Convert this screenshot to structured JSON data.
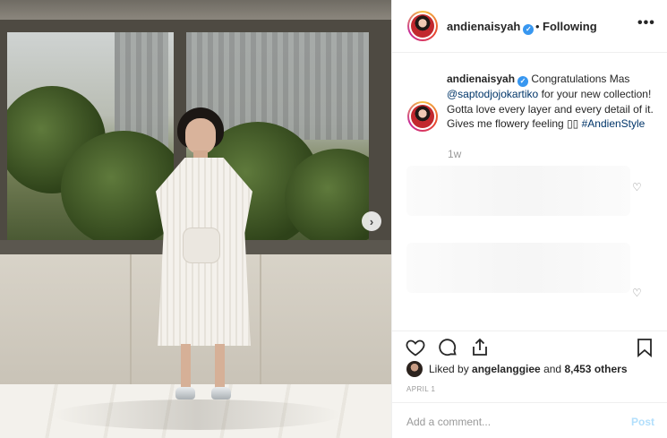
{
  "post": {
    "image_alt": "photo"
  },
  "header": {
    "username": "andienaisyah",
    "separator": "•",
    "follow_status": "Following",
    "more": "•••"
  },
  "caption": {
    "username": "andienaisyah",
    "text_before_mention": "Congratulations Mas",
    "mention": "@saptodjojokartiko",
    "text_after_mention": "for your new collection! Gotta love every layer and every detail of it. Gives me flowery feeling",
    "emoji": "▯▯",
    "hashtag": "#AndienStyle",
    "time_ago": "1w"
  },
  "likes": {
    "prefix": "Liked by",
    "user": "angelanggiee",
    "middle": "and",
    "count": "8,453 others"
  },
  "date": "APRIL 1",
  "comment_box": {
    "placeholder": "Add a comment...",
    "post_label": "Post"
  },
  "icons": {
    "like": "heart-icon",
    "comment": "comment-icon",
    "share": "share-icon",
    "save": "bookmark-icon",
    "verified": "verified-badge-icon",
    "next": "chevron-right-icon"
  },
  "colors": {
    "link": "#003569",
    "verified": "#3897f0",
    "muted": "#999999",
    "post_disabled": "#b2dffc"
  }
}
